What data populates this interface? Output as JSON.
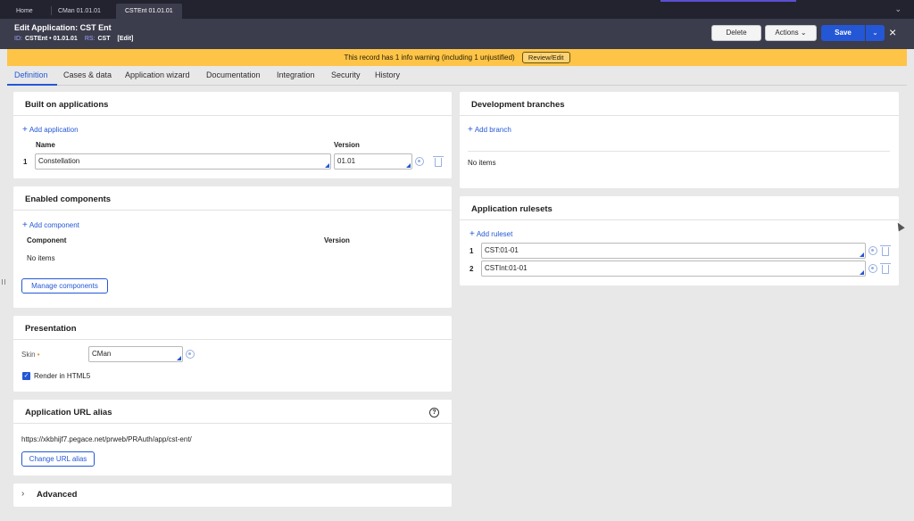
{
  "window_tabs": [
    {
      "label": "Home"
    },
    {
      "label": "CMan 01.01.01"
    },
    {
      "label": "CSTEnt 01.01.01"
    }
  ],
  "header": {
    "title": "Edit  Application: CST Ent",
    "id_label": "ID:",
    "id_value": "CSTEnt • 01.01.01",
    "rs_label": "RS:",
    "rs_value": "CST",
    "edit_link": "[Edit]",
    "delete_label": "Delete",
    "actions_label": "Actions",
    "save_label": "Save"
  },
  "banner": {
    "text": "This record has 1 info warning (including 1 unjustified)",
    "review_label": "Review/Edit"
  },
  "tabs": [
    {
      "label": "Definition"
    },
    {
      "label": "Cases & data"
    },
    {
      "label": "Application wizard"
    },
    {
      "label": "Documentation"
    },
    {
      "label": "Integration"
    },
    {
      "label": "Security"
    },
    {
      "label": "History"
    }
  ],
  "built_on": {
    "title": "Built on applications",
    "add_label": "Add application",
    "col_name": "Name",
    "col_version": "Version",
    "rows": [
      {
        "num": "1",
        "name": "Constellation",
        "version": "01.01"
      }
    ]
  },
  "components": {
    "title": "Enabled components",
    "add_label": "Add component",
    "col_component": "Component",
    "col_version": "Version",
    "empty": "No items",
    "manage_label": "Manage components"
  },
  "presentation": {
    "title": "Presentation",
    "skin_label": "Skin",
    "required_mark": "•",
    "skin_value": "CMan",
    "render_label": "Render in HTML5"
  },
  "url_alias": {
    "title": "Application URL alias",
    "help": "?",
    "url": "https://xkbhijf7.pegace.net/prweb/PRAuth/app/cst-ent/",
    "change_label": "Change URL alias"
  },
  "advanced": {
    "title": "Advanced"
  },
  "branches": {
    "title": "Development branches",
    "add_label": "Add branch",
    "empty": "No items"
  },
  "rulesets": {
    "title": "Application rulesets",
    "add_label": "Add ruleset",
    "rows": [
      {
        "num": "1",
        "value": "CST:01-01"
      },
      {
        "num": "2",
        "value": "CSTInt:01-01"
      }
    ]
  }
}
